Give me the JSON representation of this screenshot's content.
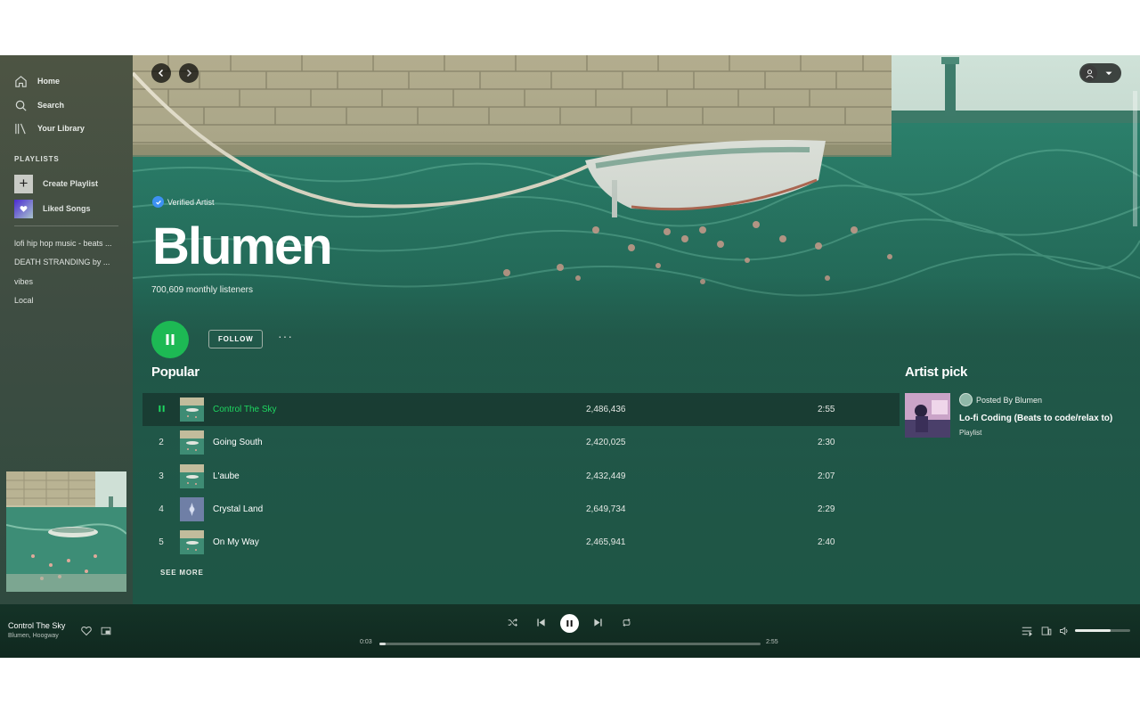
{
  "sidebar": {
    "nav": [
      {
        "label": "Home",
        "icon": "home-icon"
      },
      {
        "label": "Search",
        "icon": "search-icon"
      },
      {
        "label": "Your Library",
        "icon": "library-icon"
      }
    ],
    "playlists_heading": "PLAYLISTS",
    "create_playlist": "Create Playlist",
    "liked_songs": "Liked Songs",
    "playlists": [
      "lofi hip hop music - beats ...",
      "DEATH STRANDING by ...",
      "vibes",
      "Local"
    ]
  },
  "artist": {
    "verified_label": "Verified Artist",
    "name": "Blumen",
    "monthly_listeners": "700,609 monthly listeners",
    "follow_label": "FOLLOW",
    "more_label": "···"
  },
  "popular": {
    "title": "Popular",
    "see_more": "SEE MORE",
    "tracks": [
      {
        "num": "1",
        "title": "Control The Sky",
        "plays": "2,486,436",
        "duration": "2:55",
        "playing": true
      },
      {
        "num": "2",
        "title": "Going South",
        "plays": "2,420,025",
        "duration": "2:30",
        "playing": false
      },
      {
        "num": "3",
        "title": "L'aube",
        "plays": "2,432,449",
        "duration": "2:07",
        "playing": false
      },
      {
        "num": "4",
        "title": "Crystal Land",
        "plays": "2,649,734",
        "duration": "2:29",
        "playing": false
      },
      {
        "num": "5",
        "title": "On My Way",
        "plays": "2,465,941",
        "duration": "2:40",
        "playing": false
      }
    ]
  },
  "artist_pick": {
    "title": "Artist pick",
    "posted_by": "Posted By Blumen",
    "playlist_title": "Lo-fi Coding (Beats to code/relax to)",
    "type": "Playlist"
  },
  "player": {
    "track_title": "Control The Sky",
    "track_artists": "Blumen, Hoogway",
    "elapsed": "0:03",
    "total": "2:55",
    "progress": 0.017,
    "volume": 0.65
  },
  "colors": {
    "accent": "#1db954",
    "active_text": "#1ed760",
    "verified": "#3d91f4"
  }
}
